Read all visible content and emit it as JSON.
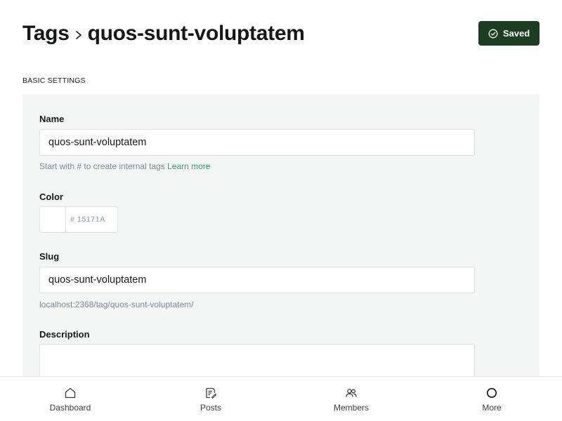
{
  "header": {
    "crumb_parent": "Tags",
    "crumb_current": "quos-sunt-voluptatem",
    "saved_label": "Saved"
  },
  "section": {
    "label": "BASIC SETTINGS"
  },
  "form": {
    "name_label": "Name",
    "name_value": "quos-sunt-voluptatem",
    "name_hint": "Start with # to create internal tags",
    "name_hint_link": "Learn more",
    "color_label": "Color",
    "color_placeholder": "# 15171A",
    "slug_label": "Slug",
    "slug_value": "quos-sunt-voluptatem",
    "slug_hint": "localhost:2368/tag/quos-sunt-voluptatem/",
    "description_label": "Description",
    "description_value": ""
  },
  "nav": {
    "items": [
      {
        "label": "Dashboard",
        "icon": "home-icon"
      },
      {
        "label": "Posts",
        "icon": "posts-icon"
      },
      {
        "label": "Members",
        "icon": "members-icon"
      },
      {
        "label": "More",
        "icon": "more-circle-icon"
      }
    ]
  },
  "colors": {
    "saved_button_bg": "#1c3d21",
    "panel_bg": "#f4f5f5",
    "link_green": "#30a46c",
    "text_dark": "#15171a",
    "hint_gray": "#7c8b9a"
  }
}
